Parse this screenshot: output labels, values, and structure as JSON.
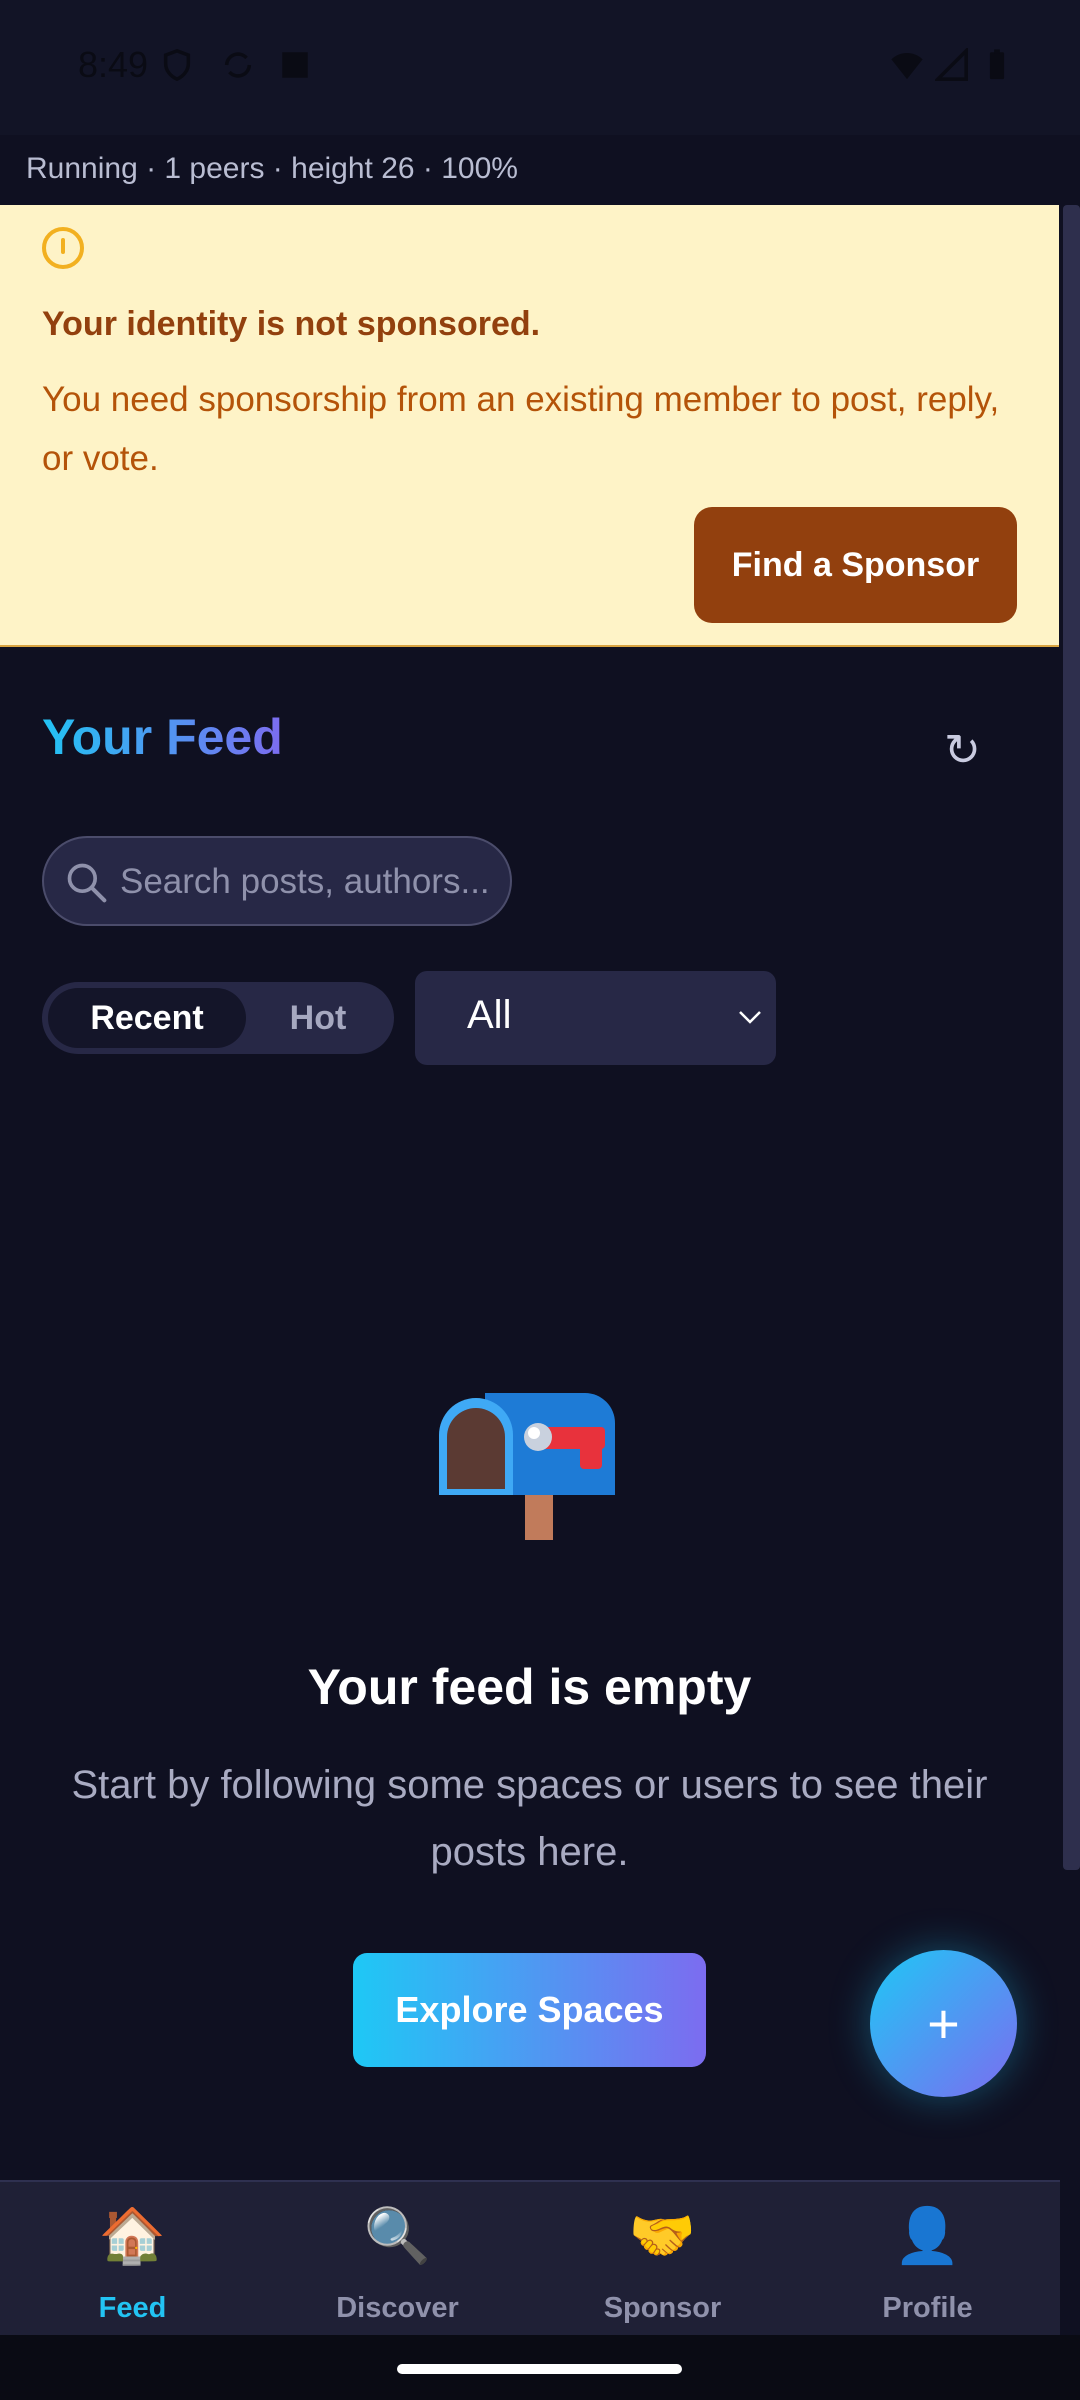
{
  "status_bar": {
    "time": "8:49"
  },
  "daemon_status": "Running · 1 peers · height 26 · 100%",
  "banner": {
    "title": "Your identity is not sponsored.",
    "text": "You need sponsorship from an existing member to post, reply, or vote.",
    "button": "Find a Sponsor"
  },
  "feed": {
    "title": "Your Feed",
    "search_placeholder": "Search posts, authors...",
    "sort_tabs": [
      "Recent",
      "Hot"
    ],
    "active_sort": "Recent",
    "filter_value": "All"
  },
  "empty_state": {
    "title": "Your feed is empty",
    "text": "Start by following some spaces or users to see their posts here.",
    "button": "Explore Spaces"
  },
  "fab": {
    "label": "+"
  },
  "bottom_nav": [
    {
      "label": "Feed",
      "icon": "🏠",
      "icon_name": "home-icon",
      "active": true
    },
    {
      "label": "Discover",
      "icon": "🔍",
      "icon_name": "search-icon",
      "active": false
    },
    {
      "label": "Sponsor",
      "icon": "🤝",
      "icon_name": "handshake-icon",
      "active": false
    },
    {
      "label": "Profile",
      "icon": "👤",
      "icon_name": "user-icon",
      "active": false
    }
  ],
  "colors": {
    "background": "#0f1021",
    "banner_bg": "#fef3c7",
    "sponsor_button": "#92400e",
    "accent_start": "#22c3f3",
    "accent_end": "#7c6cf0"
  }
}
